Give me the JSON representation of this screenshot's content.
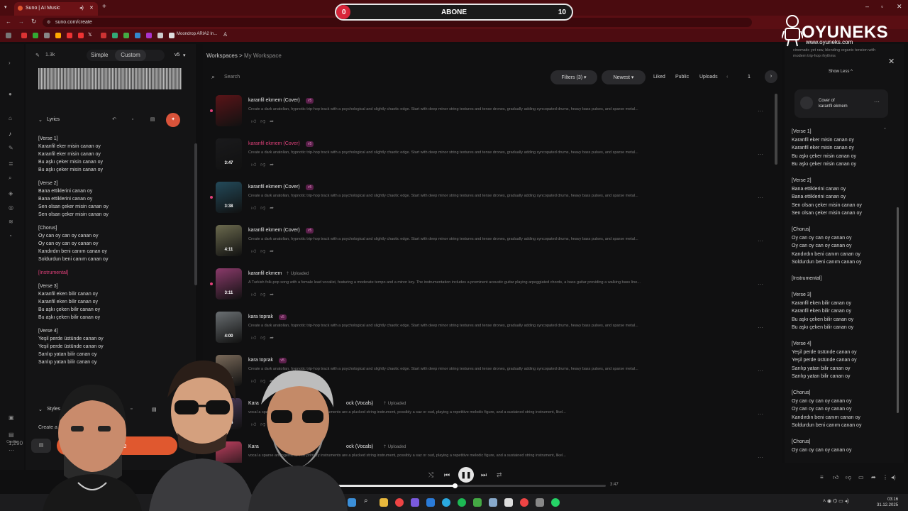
{
  "browser": {
    "tab_title": "Suno | AI Music",
    "url": "suno.com/create",
    "bookmark": "Moondrop ARIA2 In..."
  },
  "abone": {
    "left": "0",
    "center": "ABONE",
    "right": "10",
    "progress": 0.06
  },
  "watermark": {
    "brand": "OYUNEKS",
    "site": "www.oyuneks.com"
  },
  "rail": {
    "credits": "1,290",
    "credits_label": "Credits"
  },
  "create": {
    "likes": "1.3k",
    "mode_simple": "Simple",
    "mode_custom": "Custom",
    "version": "v5",
    "lyrics_label": "Lyrics",
    "styles_label": "Styles",
    "styles_text": "Create a d",
    "create_label": "Create",
    "lyrics": [
      {
        "text": "[Verse 1]"
      },
      {
        "text": "Karanfil eker misin canan oy"
      },
      {
        "text": "Karanfil eker misin canan oy"
      },
      {
        "text": "Bu aşkı çeker misin canan oy"
      },
      {
        "text": "Bu aşkı çeker misin canan oy"
      },
      {
        "text": ""
      },
      {
        "text": "[Verse 2]"
      },
      {
        "text": "Bana ettiklerini canan oy"
      },
      {
        "text": "Bana ettiklerini canan oy"
      },
      {
        "text": "Sen olsan çeker misin canan oy"
      },
      {
        "text": "Sen olsan çeker misin canan oy"
      },
      {
        "text": ""
      },
      {
        "text": "[Chorus]"
      },
      {
        "text": "Oy can oy can oy canan oy"
      },
      {
        "text": "Oy can oy can oy canan oy"
      },
      {
        "text": "Kandırdın beni canım canan oy"
      },
      {
        "text": "Soldurdun beni canım canan oy"
      },
      {
        "text": ""
      },
      {
        "text": "[Instrumental]",
        "pink": true
      },
      {
        "text": ""
      },
      {
        "text": "[Verse 3]"
      },
      {
        "text": "Karanfil eken bilir canan oy"
      },
      {
        "text": "Karanfil eken bilir canan oy"
      },
      {
        "text": "Bu aşkı çeken bilir canan oy"
      },
      {
        "text": "Bu aşkı çeken bilir canan oy"
      },
      {
        "text": ""
      },
      {
        "text": "[Verse 4]"
      },
      {
        "text": "Yeşil perde üstünde canan oy"
      },
      {
        "text": "Yeşil perde üstünde canan oy"
      },
      {
        "text": "Sarılıp yatan bilir canan oy"
      },
      {
        "text": "Sarılıp yatan bilir canan oy"
      }
    ]
  },
  "workspace": {
    "crumb_root": "Workspaces",
    "crumb_sep": ">",
    "crumb_current": "My Workspace",
    "search_placeholder": "Search",
    "filters": "Filters (3)",
    "newest": "Newest",
    "liked": "Liked",
    "public": "Public",
    "uploads": "Uploads",
    "page": "1",
    "songs": [
      {
        "title": "karanfil ekmem (Cover)",
        "badge": "v5",
        "duration": "",
        "desc": "Create a dark anatolian, hypnotic trip-hop track with a psychological and slightly chaotic edge. Start with deep minor string textures and tense drones, gradually adding syncopated drums, heavy bass pulses, and sparse metal...",
        "dot": true,
        "active": false,
        "color": "#5a1418"
      },
      {
        "title": "karanfil ekmem (Cover)",
        "badge": "v5",
        "duration": "3:47",
        "desc": "Create a dark anatolian, hypnotic trip-hop track with a psychological and slightly chaotic edge. Start with deep minor string textures and tense drones, gradually adding syncopated drums, heavy bass pulses, and sparse metal...",
        "dot": false,
        "active": true,
        "color": "#1a1a1c"
      },
      {
        "title": "karanfil ekmem (Cover)",
        "badge": "v5",
        "duration": "3:38",
        "desc": "Create a dark anatolian, hypnotic trip-hop track with a psychological and slightly chaotic edge. Start with deep minor string textures and tense drones, gradually adding syncopated drums, heavy bass pulses, and sparse metal...",
        "dot": true,
        "active": false,
        "color": "#234a5a"
      },
      {
        "title": "karanfil ekmem (Cover)",
        "badge": "v5",
        "duration": "4:11",
        "desc": "Create a dark anatolian, hypnotic trip-hop track with a psychological and slightly chaotic edge. Start with deep minor string textures and tense drones, gradually adding syncopated drums, heavy bass pulses, and sparse metal...",
        "dot": false,
        "active": false,
        "color": "#6b6a4e"
      },
      {
        "title": "karanfil ekmem",
        "badge": "",
        "uploaded": "Uploaded",
        "duration": "3:11",
        "desc": "A Turkish folk-pop song with a female lead vocalist, featuring a moderate tempo and a minor key. The instrumentation includes a prominent acoustic guitar playing arpeggiated chords, a bass guitar providing a walking bass line...",
        "dot": true,
        "active": false,
        "color": "#8a3a6a"
      },
      {
        "title": "kara toprak",
        "badge": "v5",
        "duration": "4:00",
        "desc": "Create a dark anatolian, hypnotic trip-hop track with a psychological and slightly chaotic edge. Start with deep minor string textures and tense drones, gradually adding syncopated drums, heavy bass pulses, and sparse metal...",
        "dot": false,
        "active": false,
        "color": "#6a6f72"
      },
      {
        "title": "kara toprak",
        "badge": "v5",
        "duration": "4:21",
        "desc": "Create a dark anatolian, hypnotic trip-hop track with a psychological and slightly chaotic edge. Start with deep minor string textures and tense drones, gradually adding syncopated drums, heavy bass pulses, and sparse metal...",
        "dot": false,
        "active": false,
        "color": "#7a6a5a"
      },
      {
        "title": "Kara",
        "badge": "",
        "uploaded": "Uploaded",
        "title_tail": "ock (Vocals)",
        "duration": "4:44",
        "desc": "vocal a sparse arrangement. The primary instruments are a plucked string instrument, possibly a saz or oud, playing a repetitive melodic figure, and a sustained string instrument, likel...",
        "dot": false,
        "active": false,
        "color": "#4a3a5a"
      },
      {
        "title": "Kara",
        "badge": "",
        "uploaded": "Uploaded",
        "title_tail": "ock (Vocals)",
        "duration": "",
        "desc": "vocal a sparse arrangement. The primary instruments are a plucked string instrument, possibly a saz or oud, playing a repetitive melodic figure, and a sustained string instrument, likel...",
        "dot": false,
        "active": false,
        "color": "#c04060"
      }
    ]
  },
  "right": {
    "desc": "cinematic yet raw, blending organic tension with modern trip-hop rhythms",
    "show_less": "Show Less",
    "cover_of": "Cover of",
    "cover_title": "karanfil ekmem",
    "lyrics": [
      "[Verse 1]",
      "Karanfil eker misin canan oy",
      "Karanfil eker misin canan oy",
      "Bu aşkı çeker misin canan oy",
      "Bu aşkı çeker misin canan oy",
      "",
      "[Verse 2]",
      "Bana ettiklerini canan oy",
      "Bana ettiklerini canan oy",
      "Sen olsan çeker misin canan oy",
      "Sen olsan çeker misin canan oy",
      "",
      "[Chorus]",
      "Oy can oy can oy canan oy",
      "Oy can oy can oy canan oy",
      "Kandırdın beni canım canan oy",
      "Soldurdun beni canım canan oy",
      "",
      "[Instrumental]",
      "",
      "[Verse 3]",
      "Karanfil eken bilir canan oy",
      "Karanfil eken bilir canan oy",
      "Bu aşkı çeken bilir canan oy",
      "Bu aşkı çeken bilir canan oy",
      "",
      "[Verse 4]",
      "Yeşil perde üstünde canan oy",
      "Yeşil perde üstünde canan oy",
      "Sarılıp yatan bilir canan oy",
      "Sarılıp yatan bilir canan oy",
      "",
      "[Chorus]",
      "Oy can oy can oy canan oy",
      "Oy can oy can oy canan oy",
      "Kandırdın beni canım canan oy",
      "Soldurdun beni canım canan oy",
      "",
      "[Chorus]",
      "Oy can oy can oy canan oy"
    ]
  },
  "player": {
    "total": "3:47",
    "progress": 0.46
  },
  "taskbar": {
    "time": "03:16",
    "date": "31.12.2025"
  },
  "colors": {
    "accent": "#e0407a",
    "create": "#e0582f",
    "abone_red": "#d9253a"
  }
}
